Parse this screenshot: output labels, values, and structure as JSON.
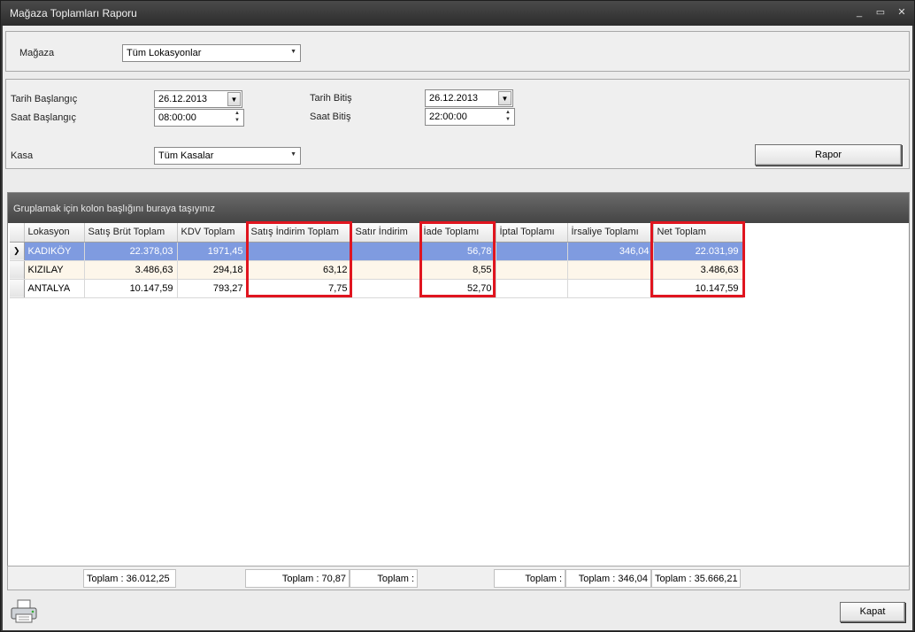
{
  "window": {
    "title": "Mağaza Toplamları Raporu",
    "controls": [
      "_",
      "▭",
      "✕"
    ]
  },
  "store_filter": {
    "label": "Mağaza",
    "value": "Tüm Lokasyonlar"
  },
  "date_filter": {
    "start_date_label": "Tarih Başlangıç",
    "start_date_value": "26.12.2013",
    "start_time_label": "Saat Başlangıç",
    "start_time_value": "08:00:00",
    "end_date_label": "Tarih Bitiş",
    "end_date_value": "26.12.2013",
    "end_time_label": "Saat Bitiş",
    "end_time_value": "22:00:00",
    "register_label": "Kasa",
    "register_value": "Tüm Kasalar",
    "report_button": "Rapor"
  },
  "grid": {
    "group_panel_text": "Gruplamak için kolon başlığını buraya taşıyınız",
    "columns": [
      "Lokasyon",
      "Satış Brüt Toplam",
      "KDV Toplam",
      "Satış İndirim Toplam",
      "Satır İndirim",
      "İade Toplamı",
      "İptal Toplamı",
      "İrsaliye Toplamı",
      "Net Toplam"
    ],
    "rows": [
      {
        "indicator": "❯",
        "cells": [
          "KADIKÖY",
          "22.378,03",
          "1971,45",
          "",
          "",
          "56,78",
          "",
          "346,04",
          "22.031,99"
        ]
      },
      {
        "indicator": "",
        "cells": [
          "KIZILAY",
          "3.486,63",
          "294,18",
          "63,12",
          "",
          "8,55",
          "",
          "",
          "3.486,63"
        ]
      },
      {
        "indicator": "",
        "cells": [
          "ANTALYA",
          "10.147,59",
          "793,27",
          "7,75",
          "",
          "52,70",
          "",
          "",
          "10.147,59"
        ]
      }
    ],
    "footer": [
      "Toplam : 36.012,25",
      "Toplam : 70,87",
      "Toplam :",
      "Toplam :",
      "Toplam : 346,04",
      "Toplam : 35.666,21"
    ]
  },
  "close_button": "Kapat",
  "icons": {
    "printer": "printer-icon",
    "dropdown": "chevron-down-icon"
  },
  "colors": {
    "selected_row": "#7f9be0",
    "highlight": "#e0151f",
    "alt_row": "#fdf6ea"
  }
}
